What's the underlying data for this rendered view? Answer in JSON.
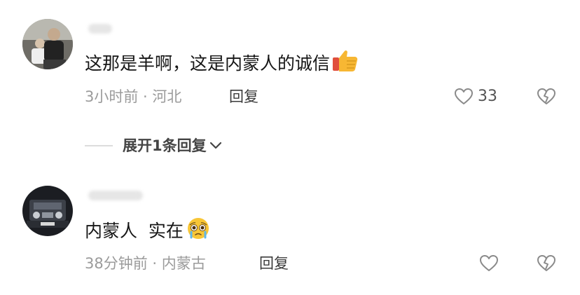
{
  "comments": [
    {
      "avatar": "user-photo-avatar",
      "text": "这那是羊啊，这是内蒙人的诚信",
      "emoji": "thumbs-up-emoji",
      "time": "3小时前",
      "location": "河北",
      "reply_label": "回复",
      "likes": "33",
      "expand_replies": "展开1条回复"
    },
    {
      "avatar": "car-photo-avatar",
      "text": "内蒙人  实在",
      "emoji": "pleading-face-emoji",
      "time": "38分钟前",
      "location": "内蒙古",
      "reply_label": "回复",
      "likes": ""
    }
  ],
  "meta_separator": " · ",
  "icons": {
    "like": "heart-outline-icon",
    "dislike": "broken-heart-outline-icon",
    "expand": "chevron-down-icon"
  },
  "colors": {
    "text": "#161616",
    "meta": "#9b9b9b",
    "icon": "#8a8a8a"
  }
}
